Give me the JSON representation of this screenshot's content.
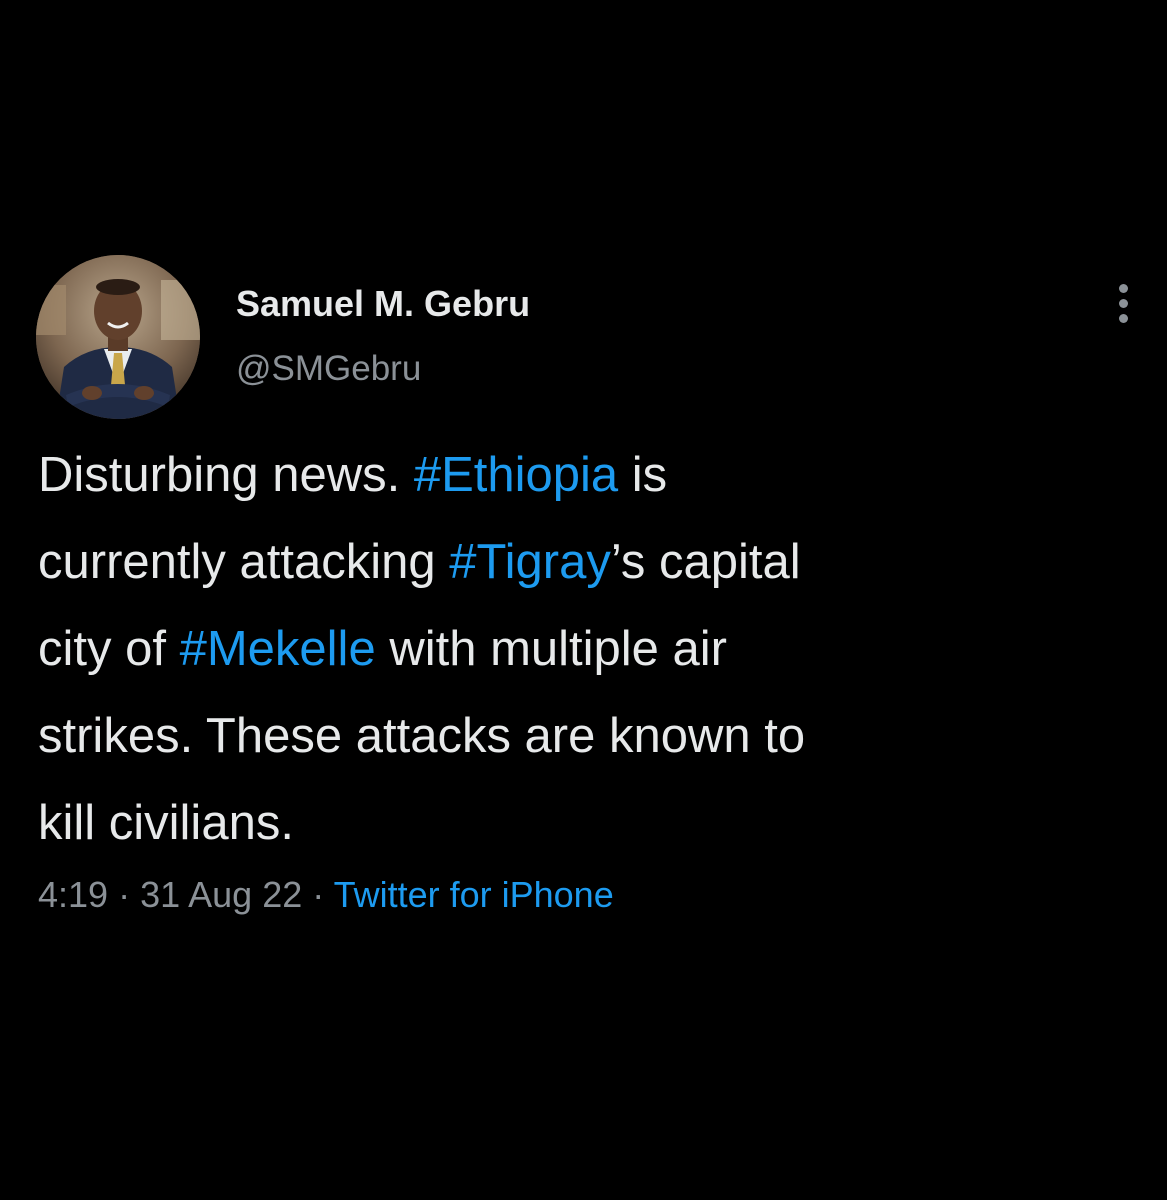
{
  "user": {
    "display_name": "Samuel M. Gebru",
    "handle": "@SMGebru",
    "avatar": "profile-photo"
  },
  "menu": {
    "icon": "more-vertical-icon"
  },
  "tweet": {
    "lines": [
      [
        {
          "text": "Disturbing news. ",
          "hashtag": false
        },
        {
          "text": "#Ethiopia",
          "hashtag": true
        },
        {
          "text": " is",
          "hashtag": false
        }
      ],
      [
        {
          "text": "currently attacking ",
          "hashtag": false
        },
        {
          "text": "#Tigray",
          "hashtag": true
        },
        {
          "text": "’s capital",
          "hashtag": false
        }
      ],
      [
        {
          "text": "city of ",
          "hashtag": false
        },
        {
          "text": "#Mekelle",
          "hashtag": true
        },
        {
          "text": " with multiple air",
          "hashtag": false
        }
      ],
      [
        {
          "text": "strikes. These attacks are known to",
          "hashtag": false
        }
      ],
      [
        {
          "text": "kill civilians.",
          "hashtag": false
        }
      ]
    ]
  },
  "meta": {
    "time": "4:19",
    "separator": " · ",
    "date": "31 Aug 22",
    "source": "Twitter for iPhone"
  },
  "colors": {
    "background": "#000000",
    "text": "#e7e9ea",
    "muted": "#8b9197",
    "accent": "#1d9bf0"
  }
}
